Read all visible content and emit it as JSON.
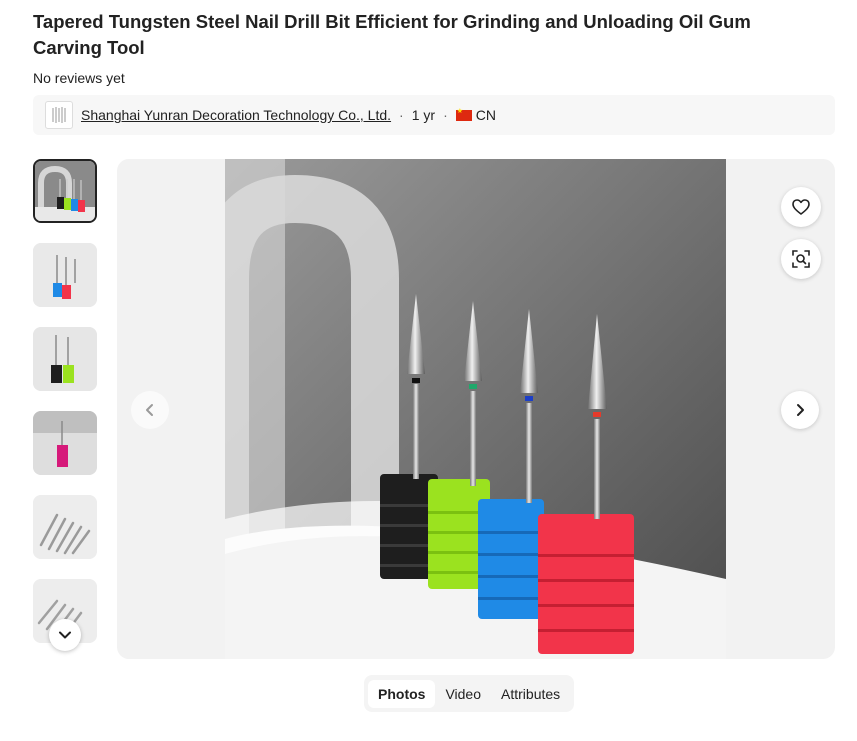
{
  "product": {
    "title": "Tapered Tungsten Steel Nail Drill Bit Efficient for Grinding and Unloading Oil Gum Carving Tool",
    "reviews": "No reviews yet"
  },
  "supplier": {
    "name": "Shanghai Yunran Decoration Technology Co., Ltd.",
    "years": "1 yr",
    "country": "CN"
  },
  "gallery": {
    "thumbnail_count": 6,
    "active_index": 0
  },
  "tabs": [
    {
      "label": "Photos",
      "active": true
    },
    {
      "label": "Video",
      "active": false
    },
    {
      "label": "Attributes",
      "active": false
    }
  ],
  "icons": {
    "favorite": "heart-icon",
    "image_search": "image-search-icon",
    "prev": "chevron-left-icon",
    "next": "chevron-right-icon",
    "thumbs_more": "chevron-down-icon"
  },
  "colors": {
    "holder_black": "#1e1e1e",
    "holder_green": "#9be21f",
    "holder_blue": "#1f8ae6",
    "holder_red": "#f2344a",
    "ring_black": "#111111",
    "ring_green": "#1fa86b",
    "ring_blue": "#1d3fc7",
    "ring_red": "#e53a2b"
  }
}
